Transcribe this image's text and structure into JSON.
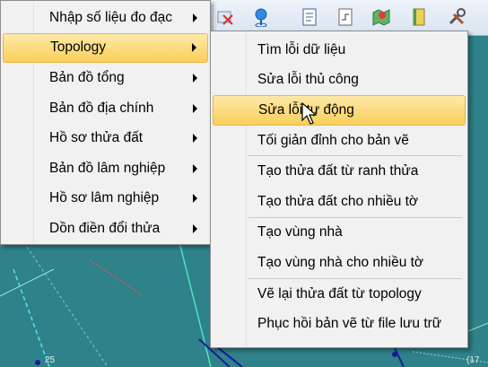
{
  "canvas": {
    "labels": [
      "(17",
      "25"
    ],
    "background_color": "#2f8289"
  },
  "toolbar": {
    "icons": [
      "close-x-icon",
      "location-pin-icon",
      "document-list-icon",
      "layer-step-icon",
      "map-pin-icon",
      "book-icon",
      "tools-icon"
    ]
  },
  "main_menu": {
    "items": [
      {
        "label": "Nhập số liệu đo đạc",
        "submenu": true,
        "highlighted": false
      },
      {
        "label": "Topology",
        "submenu": true,
        "highlighted": true
      },
      {
        "label": "Bản đồ tổng",
        "submenu": true,
        "highlighted": false
      },
      {
        "label": "Bản đồ địa chính",
        "submenu": true,
        "highlighted": false
      },
      {
        "label": "Hồ sơ thửa đất",
        "submenu": true,
        "highlighted": false
      },
      {
        "label": "Bản đồ lâm nghiệp",
        "submenu": true,
        "highlighted": false
      },
      {
        "label": "Hồ sơ lâm nghiệp",
        "submenu": true,
        "highlighted": false
      },
      {
        "label": "Dồn điền đổi thửa",
        "submenu": true,
        "highlighted": false
      }
    ]
  },
  "topology_menu": {
    "groups": [
      [
        "Tìm lỗi dữ liệu",
        "Sửa lỗi thủ công",
        "Sửa lỗi tự động",
        "Tối giản đỉnh cho bản vẽ"
      ],
      [
        "Tạo thửa đất từ ranh thửa",
        "Tạo thửa đất cho nhiều tờ"
      ],
      [
        "Tạo vùng nhà",
        "Tạo vùng nhà cho nhiều tờ"
      ],
      [
        "Vẽ lại thửa đất từ topology",
        "Phục hồi bản vẽ từ file lưu trữ"
      ]
    ],
    "highlighted": "Sửa lỗi tự động"
  },
  "colors": {
    "highlight_top": "#fde9a8",
    "highlight_bottom": "#f9cf5a",
    "menu_bg": "#f1f1f1"
  }
}
